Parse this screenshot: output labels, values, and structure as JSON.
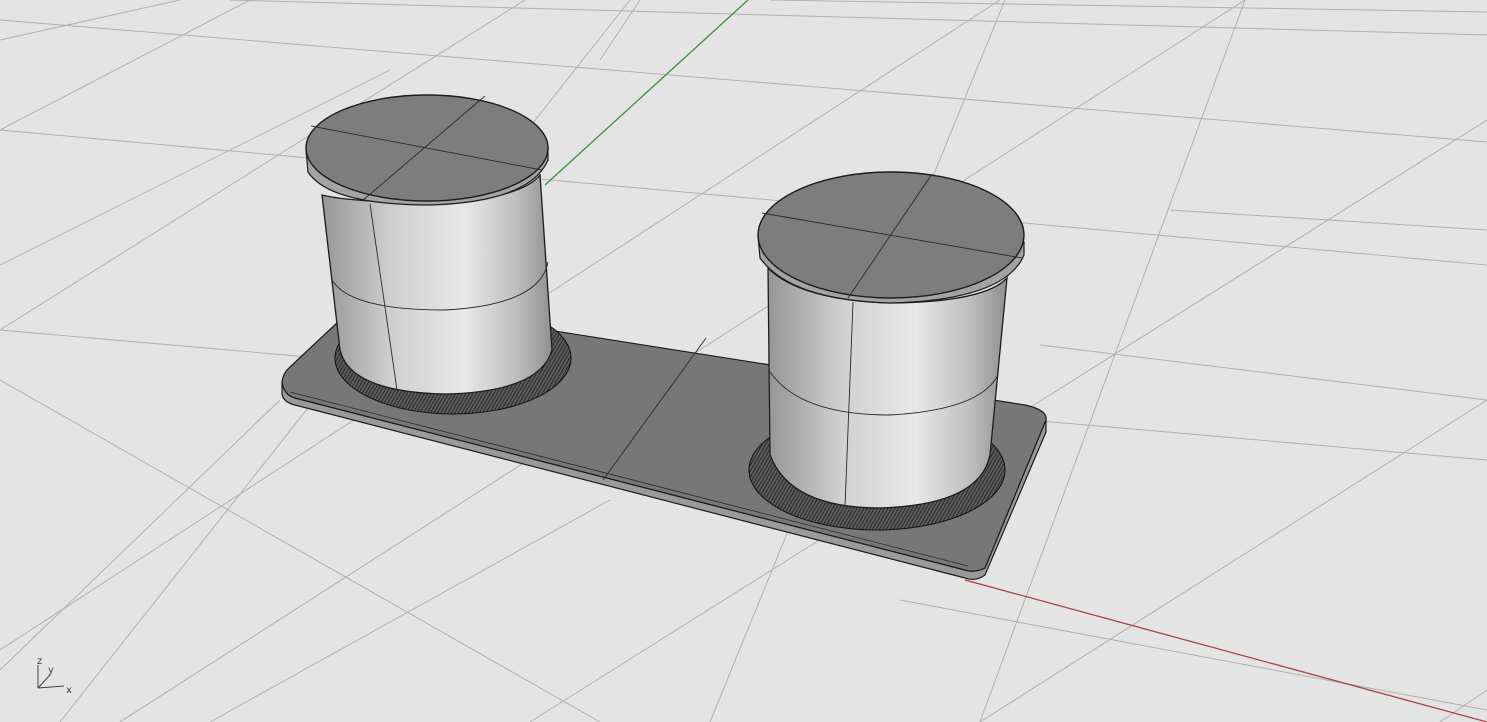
{
  "viewport": {
    "background": "#e4e4e4",
    "grid_color": "#b0b0b0",
    "x_axis_color": "#a84444",
    "y_axis_color": "#3f8f3f",
    "edge_color": "#1c1c1c",
    "shade_color": "#8a8a8a",
    "cylinder_shading": [
      "#959595",
      "#cfcfcf",
      "#e8e8e8",
      "#bdbdbd",
      "#8f8f8f"
    ]
  },
  "axis_triad": {
    "z_label": "z",
    "y_label": "y",
    "x_label": "x"
  }
}
